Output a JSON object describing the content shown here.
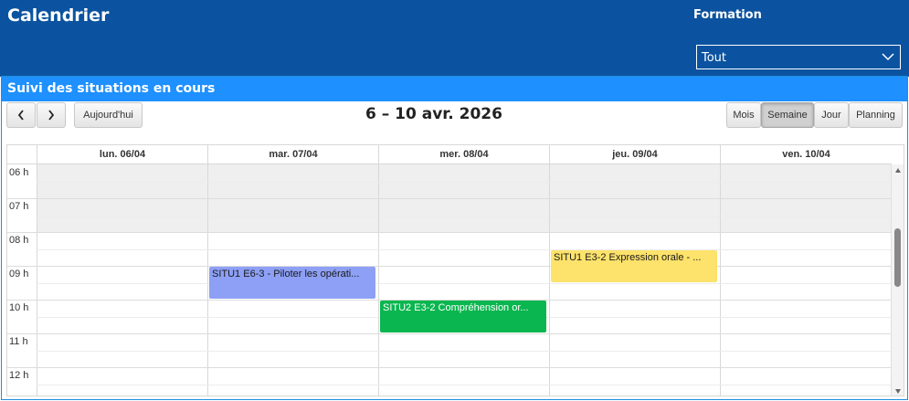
{
  "app": {
    "title": "Calendrier"
  },
  "filter": {
    "label": "Formation",
    "selected": "Tout"
  },
  "panel": {
    "title": "Suivi des situations en cours"
  },
  "toolbar": {
    "today_label": "Aujourd'hui",
    "date_range": "6 – 10 avr. 2026",
    "views": [
      "Mois",
      "Semaine",
      "Jour",
      "Planning"
    ],
    "active_view": "Semaine"
  },
  "days": [
    "lun. 06/04",
    "mar. 07/04",
    "mer. 08/04",
    "jeu. 09/04",
    "ven. 10/04"
  ],
  "hours": [
    "06 h",
    "07 h",
    "08 h",
    "09 h",
    "10 h",
    "11 h",
    "12 h"
  ],
  "events": [
    {
      "title": "SITU1 E6-3 - Piloter les opérati...",
      "day_index": 1,
      "start_hour": 9.0,
      "end_hour": 10.0,
      "bg": "#8da0f6",
      "fg": "#1a1a1a"
    },
    {
      "title": "SITU2 E3-2 Compréhension or...",
      "day_index": 2,
      "start_hour": 10.0,
      "end_hour": 11.0,
      "bg": "#0ab64f",
      "fg": "#ffffff"
    },
    {
      "title": "SITU1 E3-2 Expression orale - ...",
      "day_index": 3,
      "start_hour": 8.5,
      "end_hour": 9.5,
      "bg": "#fde26b",
      "fg": "#1a1a1a"
    }
  ],
  "colors": {
    "header_bg": "#0b53a0",
    "panel_header_bg": "#1e90ff"
  }
}
